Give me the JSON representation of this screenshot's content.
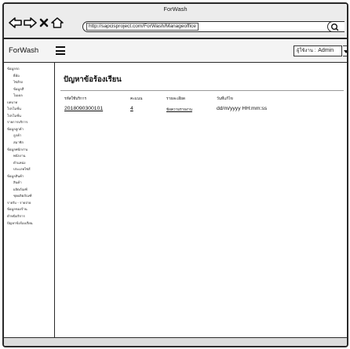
{
  "window": {
    "title": "ForWash",
    "url": "http://sapcisproject.com/ForWash/Manageoffice"
  },
  "icons": [
    "back-arrow-icon",
    "forward-arrow-icon",
    "close-icon",
    "home-icon",
    "search-icon",
    "menu-icon",
    "chevron-down-icon"
  ],
  "header": {
    "brand": "ForWash",
    "user_label": "ผู้ใช้งาน :",
    "user_name": "Admin"
  },
  "sidebar": {
    "items": [
      {
        "label": "ข้อมูลรถ",
        "level": 0
      },
      {
        "label": "ยี่ห้อ",
        "level": 1
      },
      {
        "label": "ไซส์รถ",
        "level": 1
      },
      {
        "label": "ข้อมูลสี",
        "level": 1
      },
      {
        "label": "โมเดล",
        "level": 1
      },
      {
        "label": "บทบาท",
        "level": 0
      },
      {
        "label": "โปรโมชั่น",
        "level": 0
      },
      {
        "label": "โปรโมชั่น",
        "level": 0
      },
      {
        "label": "รายการบริการ",
        "level": 0
      },
      {
        "label": "ข้อมูลลูกค้า",
        "level": 0
      },
      {
        "label": "ลูกค้า",
        "level": 1
      },
      {
        "label": "สมาชิก",
        "level": 1
      },
      {
        "label": "ข้อมูลพนักงาน",
        "level": 0
      },
      {
        "label": "พนักงาน",
        "level": 1
      },
      {
        "label": "ตำแหน่ง",
        "level": 1
      },
      {
        "label": "ประเภทไซส์",
        "level": 1
      },
      {
        "label": "ข้อมูลสินค้า",
        "level": 0
      },
      {
        "label": "สินค้า",
        "level": 1
      },
      {
        "label": "ผลิตภัณฑ์",
        "level": 1
      },
      {
        "label": "ชุดผลิตภัณฑ์",
        "level": 1
      },
      {
        "label": "รายรับ - รายจ่าย",
        "level": 0
      },
      {
        "label": "ข้อมูลของร้าน",
        "level": 0
      },
      {
        "label": "ตำหนิบริการ",
        "level": 0
      },
      {
        "label": "ปัญหาข้อร้องเรียน",
        "level": 0
      }
    ]
  },
  "main": {
    "title": "ปัญหาข้อร้องเรียน",
    "table": {
      "headers": [
        "รหัสใช้บริการ",
        "คะแนน",
        "รายละเอียด",
        "วันที่แก้ไข"
      ],
      "rows": [
        [
          "2018090300101",
          "4",
          "ข้อความรายงาน",
          "dd/m/yyyy HH:mm:ss"
        ]
      ]
    }
  }
}
